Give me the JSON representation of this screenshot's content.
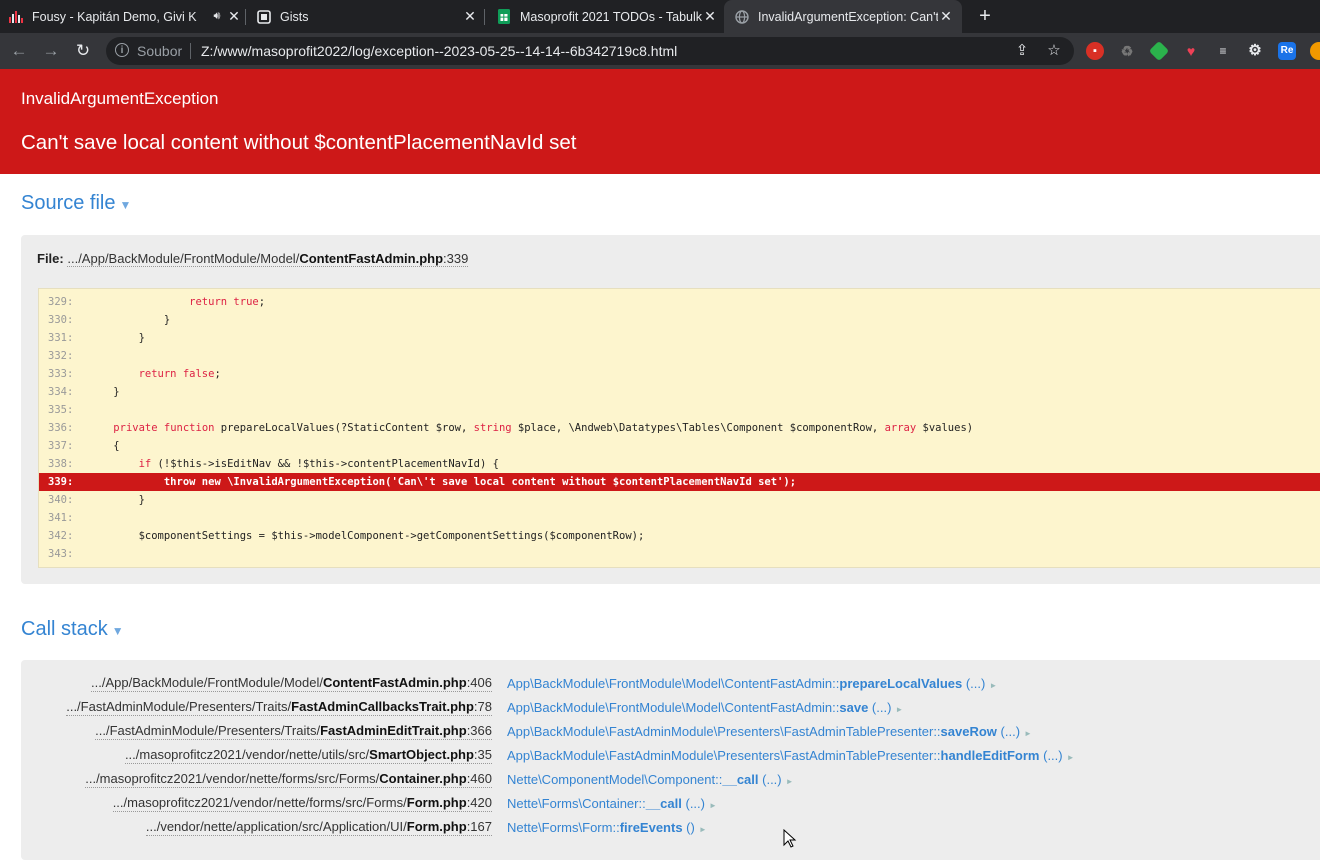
{
  "browser": {
    "tabs": [
      {
        "title": "Fousy - Kapitán Demo, Givi K",
        "icon": "music-bars-icon",
        "audio": true,
        "active": false
      },
      {
        "title": "Gists",
        "icon": "gist-icon",
        "active": false
      },
      {
        "title": "Masoprofit 2021 TODOs - Tabulk",
        "icon": "sheets-icon",
        "active": false
      },
      {
        "title": "InvalidArgumentException: Can't",
        "icon": "globe-icon",
        "active": true
      }
    ],
    "omnibox": {
      "source_label": "Soubor",
      "url": "Z:/www/masoprofit2022/log/exception--2023-05-25--14-14--6b342719c8.html"
    },
    "extension_icons": [
      "trash-extension-icon",
      "recycle-extension-icon",
      "feedly-extension-icon",
      "pocket-extension-icon",
      "stack-extension-icon",
      "gear-extension-icon",
      "re-extension-icon",
      "orange-extension-icon"
    ],
    "colors": {
      "tabbar": "#202124",
      "toolbar": "#35363a"
    }
  },
  "exception": {
    "type": "InvalidArgumentException",
    "message": "Can't save local content without $contentPlacementNavId set",
    "header_color": "#cd1818"
  },
  "source_file": {
    "title": "Source file",
    "file_label": "File:",
    "path_prefix": ".../App/BackModule/FrontModule/Model/",
    "file_name": "ContentFastAdmin.php",
    "line_suffix": ":339",
    "lines": [
      {
        "num": "329:",
        "code": "                return true;"
      },
      {
        "num": "330:",
        "code": "            }"
      },
      {
        "num": "331:",
        "code": "        }"
      },
      {
        "num": "332:",
        "code": ""
      },
      {
        "num": "333:",
        "code": "        return false;"
      },
      {
        "num": "334:",
        "code": "    }"
      },
      {
        "num": "335:",
        "code": ""
      },
      {
        "num": "336:",
        "code": "    private function prepareLocalValues(?StaticContent $row, string $place, \\Andweb\\Datatypes\\Tables\\Component $componentRow, array $values)"
      },
      {
        "num": "337:",
        "code": "    {"
      },
      {
        "num": "338:",
        "code": "        if (!$this->isEditNav && !$this->contentPlacementNavId) {"
      },
      {
        "num": "339:",
        "code": "            throw new \\InvalidArgumentException('Can\\'t save local content without $contentPlacementNavId set');",
        "highlight": true
      },
      {
        "num": "340:",
        "code": "        }"
      },
      {
        "num": "341:",
        "code": ""
      },
      {
        "num": "342:",
        "code": "        $componentSettings = $this->modelComponent->getComponentSettings($componentRow);"
      },
      {
        "num": "343:",
        "code": ""
      }
    ]
  },
  "call_stack": {
    "title": "Call stack",
    "rows": [
      {
        "path": ".../App/BackModule/FrontModule/Model/",
        "file": "ContentFastAdmin.php",
        "line": ":406",
        "cls": "App\\BackModule\\FrontModule\\Model\\ContentFastAdmin::",
        "method": "prepareLocalValues",
        "args": " (...)"
      },
      {
        "path": ".../FastAdminModule/Presenters/Traits/",
        "file": "FastAdminCallbacksTrait.php",
        "line": ":78",
        "cls": "App\\BackModule\\FrontModule\\Model\\ContentFastAdmin::",
        "method": "save",
        "args": " (...)"
      },
      {
        "path": ".../FastAdminModule/Presenters/Traits/",
        "file": "FastAdminEditTrait.php",
        "line": ":366",
        "cls": "App\\BackModule\\FastAdminModule\\Presenters\\FastAdminTablePresenter::",
        "method": "saveRow",
        "args": " (...)"
      },
      {
        "path": ".../masoprofitcz2021/vendor/nette/utils/src/",
        "file": "SmartObject.php",
        "line": ":35",
        "cls": "App\\BackModule\\FastAdminModule\\Presenters\\FastAdminTablePresenter::",
        "method": "handleEditForm",
        "args": " (...)"
      },
      {
        "path": ".../masoprofitcz2021/vendor/nette/forms/src/Forms/",
        "file": "Container.php",
        "line": ":460",
        "cls": "Nette\\ComponentModel\\Component::",
        "method": "__call",
        "args": " (...)"
      },
      {
        "path": ".../masoprofitcz2021/vendor/nette/forms/src/Forms/",
        "file": "Form.php",
        "line": ":420",
        "cls": "Nette\\Forms\\Container::",
        "method": "__call",
        "args": " (...)"
      },
      {
        "path": ".../vendor/nette/application/src/Application/UI/",
        "file": "Form.php",
        "line": ":167",
        "cls": "Nette\\Forms\\Form::",
        "method": "fireEvents",
        "args": " ()"
      }
    ]
  }
}
